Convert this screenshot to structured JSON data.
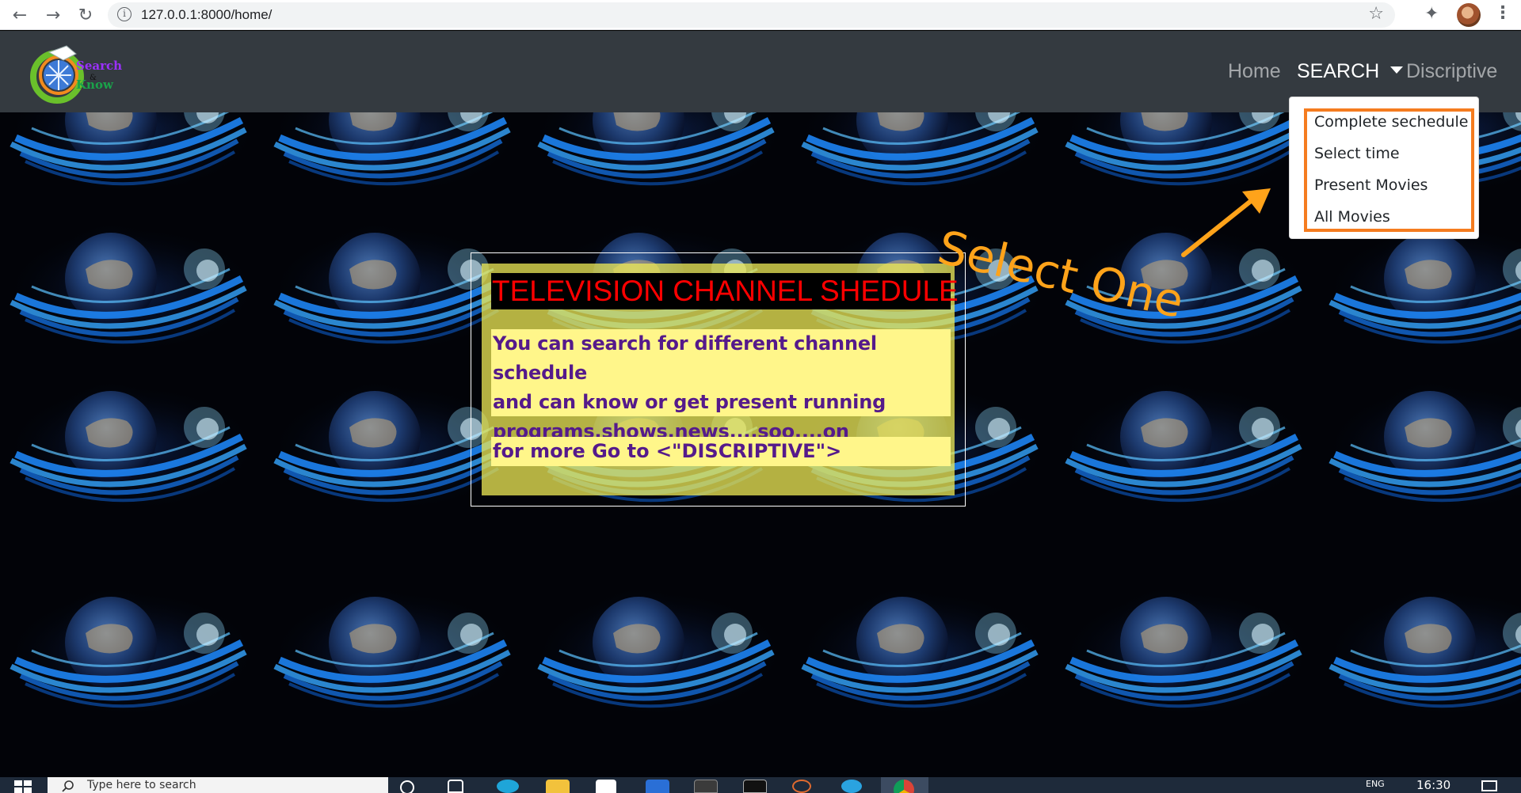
{
  "browser": {
    "url": "127.0.0.1:8000/home/",
    "icons": [
      "back-arrow-icon",
      "forward-arrow-icon",
      "reload-icon",
      "info-icon",
      "star-icon",
      "extensions-icon",
      "profile-avatar",
      "menu-kebab-icon"
    ]
  },
  "navbar": {
    "logo_text_top": "Search",
    "logo_text_mid": "&",
    "logo_text_bottom": "Know",
    "links": {
      "home": "Home",
      "search": "SEARCH",
      "discriptive": "Discriptive"
    }
  },
  "dropdown": {
    "items": [
      "Complete sechedule",
      "Select time",
      "Present Movies",
      "All Movies"
    ]
  },
  "annotation": {
    "text": "Select One",
    "color": "#ffa31a"
  },
  "card": {
    "title": "TELEVISION CHANNEL SHEDULE",
    "body_line1": "You can search for different channel schedule",
    "body_line2": "and can know or get present running",
    "body_line3": "programs,shows,news....soo....on",
    "more": "for more Go to <\"DISCRIPTIVE\">"
  },
  "taskbar": {
    "search_placeholder": "Type here to search",
    "time": "16:30",
    "lang": "ENG"
  },
  "colors": {
    "navbar": "#343a40",
    "title_text": "#ff0000",
    "body_text": "#551a8b",
    "highlight_box": "#f57c1f"
  }
}
